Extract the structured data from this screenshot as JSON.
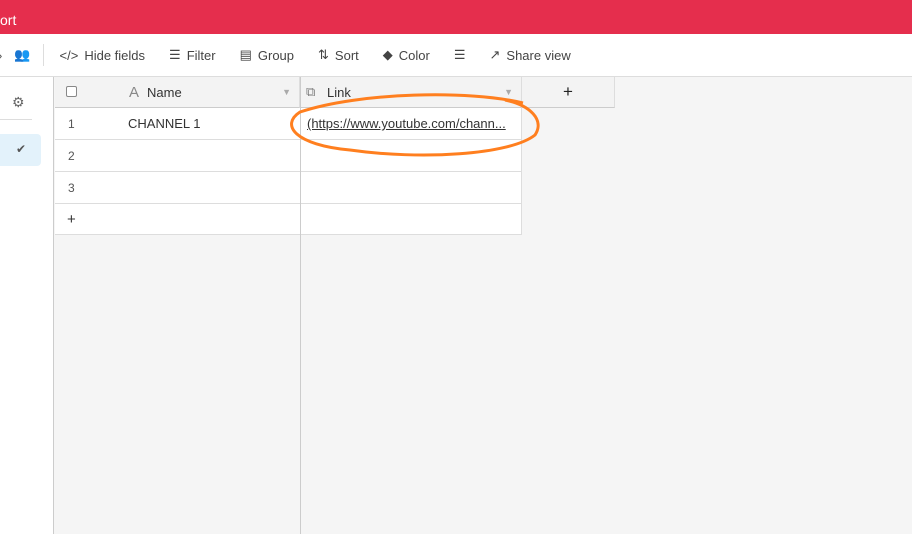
{
  "topbar": {
    "title": "ort"
  },
  "toolbar": {
    "hide_fields": "Hide fields",
    "filter": "Filter",
    "group": "Group",
    "sort": "Sort",
    "color": "Color",
    "share_view": "Share view"
  },
  "columns": [
    {
      "label": "Name",
      "icon": "text-icon"
    },
    {
      "label": "Link",
      "icon": "link-icon"
    }
  ],
  "add_column": "+",
  "rows": [
    {
      "num": "1",
      "name": "CHANNEL 1",
      "link": "(https://www.youtube.com/chann..."
    },
    {
      "num": "2",
      "name": "",
      "link": ""
    },
    {
      "num": "3",
      "name": "",
      "link": ""
    }
  ],
  "add_row": "+",
  "annotation_color": "#ff7f1f"
}
